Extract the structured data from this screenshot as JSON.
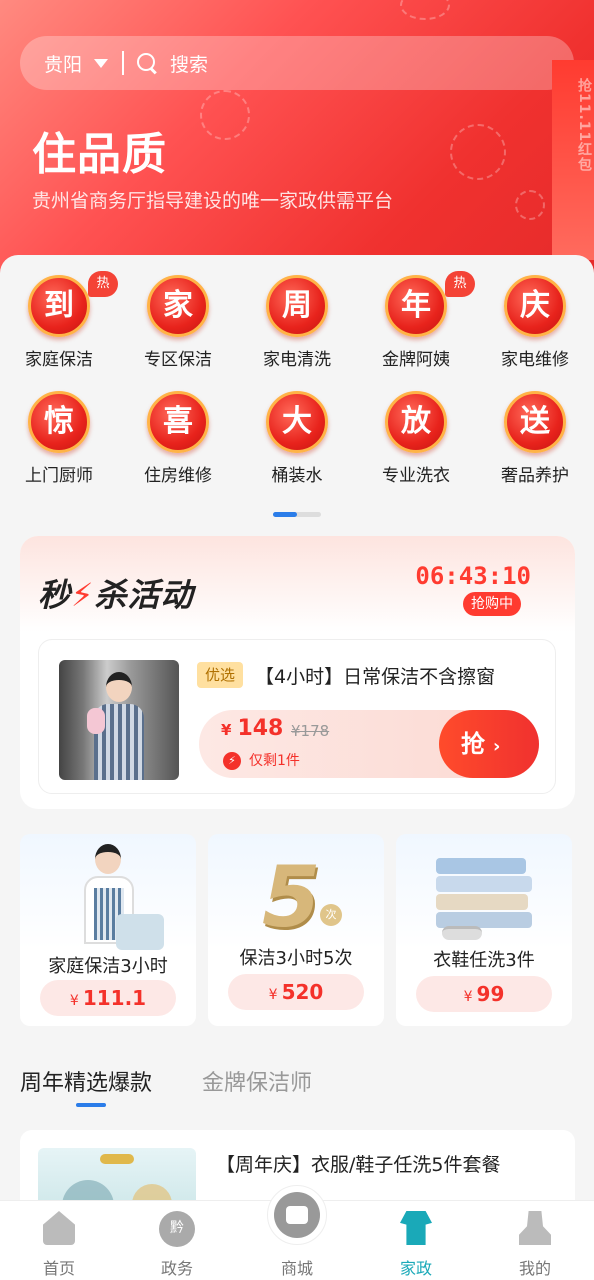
{
  "colors": {
    "brand_red": "#f0312f",
    "accent_blue": "#2b7de9",
    "active_teal": "#1aa9b8"
  },
  "header": {
    "city": "贵阳",
    "search_placeholder": "搜索",
    "title": "住品质",
    "subtitle": "贵州省商务厅指导建设的唯一家政供需平台",
    "side_stamp": "抢11.11红包"
  },
  "categories": [
    {
      "char": "到",
      "label": "家庭保洁",
      "hot": "热"
    },
    {
      "char": "家",
      "label": "专区保洁",
      "hot": ""
    },
    {
      "char": "周",
      "label": "家电清洗",
      "hot": ""
    },
    {
      "char": "年",
      "label": "金牌阿姨",
      "hot": "热"
    },
    {
      "char": "庆",
      "label": "家电维修",
      "hot": ""
    },
    {
      "char": "惊",
      "label": "上门厨师",
      "hot": ""
    },
    {
      "char": "喜",
      "label": "住房维修",
      "hot": ""
    },
    {
      "char": "大",
      "label": "桶装水",
      "hot": ""
    },
    {
      "char": "放",
      "label": "专业洗衣",
      "hot": ""
    },
    {
      "char": "送",
      "label": "奢品养护",
      "hot": ""
    }
  ],
  "flash_sale": {
    "title_a": "秒",
    "title_b": "杀活动",
    "timer": "06:43:10",
    "status": "抢购中",
    "deal": {
      "tag": "优选",
      "name": "【4小时】日常保洁不含擦窗",
      "currency": "¥",
      "price": "148",
      "old_price": "¥178",
      "stock_text": "仅剩1件",
      "button": "抢",
      "button_arrow": "›"
    }
  },
  "promos": [
    {
      "label": "家庭保洁3小时",
      "currency": "¥",
      "price": "111.1"
    },
    {
      "label": "保洁3小时5次",
      "currency": "¥",
      "price": "520",
      "big": "5",
      "unit": "次"
    },
    {
      "label": "衣鞋任洗3件",
      "currency": "¥",
      "price": "99"
    }
  ],
  "tabs": [
    {
      "label": "周年精选爆款",
      "active": true
    },
    {
      "label": "金牌保洁师",
      "active": false
    }
  ],
  "product": {
    "name": "【周年庆】衣服/鞋子任洗5件套餐"
  },
  "bottom_nav": [
    {
      "label": "首页",
      "icon": "home-icon",
      "active": false
    },
    {
      "label": "政务",
      "icon": "gov-icon",
      "active": false,
      "glyph": "黔"
    },
    {
      "label": "商城",
      "icon": "mall-icon",
      "active": false
    },
    {
      "label": "家政",
      "icon": "housekeeping-icon",
      "active": true
    },
    {
      "label": "我的",
      "icon": "profile-icon",
      "active": false
    }
  ]
}
